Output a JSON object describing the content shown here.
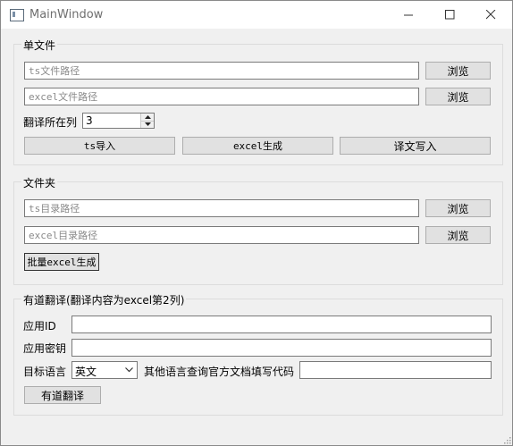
{
  "window": {
    "title": "MainWindow"
  },
  "single_file": {
    "group_title": "单文件",
    "ts_path": {
      "placeholder": "ts文件路径",
      "value": ""
    },
    "excel_path": {
      "placeholder": "excel文件路径",
      "value": ""
    },
    "browse_label": "浏览",
    "translate_column_label": "翻译所在列",
    "translate_column_value": "3",
    "buttons": {
      "ts_import": "ts导入",
      "excel_generate": "excel生成",
      "write_translation": "译文写入"
    }
  },
  "folder": {
    "group_title": "文件夹",
    "ts_dir": {
      "placeholder": "ts目录路径",
      "value": ""
    },
    "excel_dir": {
      "placeholder": "excel目录路径",
      "value": ""
    },
    "browse_label": "浏览",
    "batch_button": "批量excel生成"
  },
  "youdao": {
    "group_title": "有道翻译(翻译内容为excel第2列)",
    "app_id_label": "应用ID",
    "app_id_value": "",
    "app_secret_label": "应用密钥",
    "app_secret_value": "",
    "target_language_label": "目标语言",
    "target_language_selected": "英文",
    "other_language_label": "其他语言查询官方文档填写代码",
    "other_language_value": "",
    "translate_button": "有道翻译"
  },
  "icons": {
    "app": "window-app-icon",
    "minimize": "minimize-icon",
    "maximize": "maximize-icon",
    "close": "close-icon",
    "spin_up": "spin-up-icon",
    "spin_down": "spin-down-icon",
    "dropdown": "chevron-down-icon",
    "resize_grip": "resize-grip-icon"
  }
}
